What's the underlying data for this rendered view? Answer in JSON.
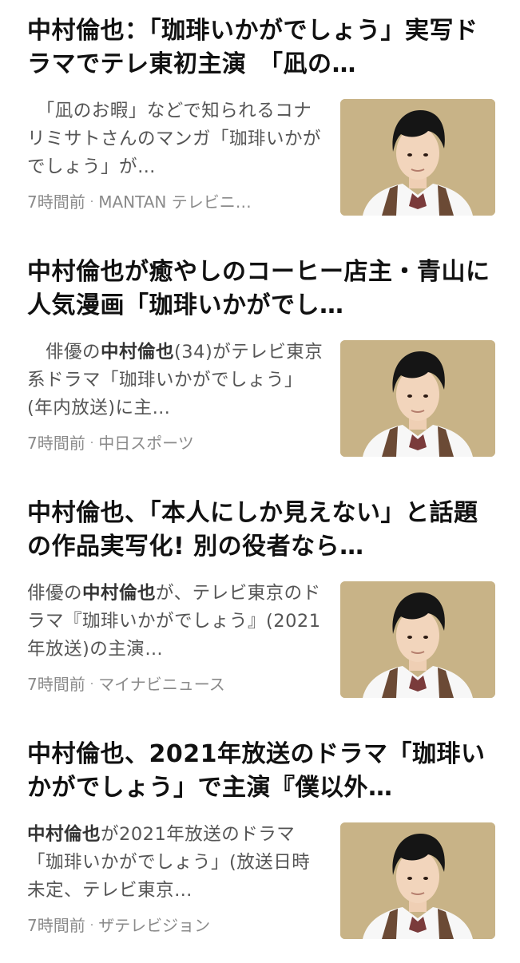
{
  "articles": [
    {
      "headline": "中村倫也：「珈琲いかがでしょう」実写ドラマでテレ東初主演　「凪の…",
      "snippet_before": "　「凪のお暇」などで知られるコナリミサトさんのマンガ「珈琲いかがでしょう」が…",
      "snippet_bold": "",
      "snippet_after": "",
      "time": "7時間前",
      "source": "MANTAN テレビニ…",
      "thumbnail_icon": "actor-portrait-thumbnail"
    },
    {
      "headline": "中村倫也が癒やしのコーヒー店主・青山に 人気漫画「珈琲いかがでし…",
      "snippet_before": "　俳優の",
      "snippet_bold": "中村倫也",
      "snippet_after": "(34)がテレビ東京系ドラマ「珈琲いかがでしょう」(年内放送)に主…",
      "time": "7時間前",
      "source": "中日スポーツ",
      "thumbnail_icon": "actor-portrait-thumbnail"
    },
    {
      "headline": "中村倫也、「本人にしか見えない」と話題の作品実写化! 別の役者なら…",
      "snippet_before": "俳優の",
      "snippet_bold": "中村倫也",
      "snippet_after": "が、テレビ東京のドラマ『珈琲いかがでしょう』(2021年放送)の主演…",
      "time": "7時間前",
      "source": "マイナビニュース",
      "thumbnail_icon": "actor-portrait-thumbnail"
    },
    {
      "headline": "中村倫也、2021年放送のドラマ「珈琲いかがでしょう」で主演『僕以外…",
      "snippet_before": "",
      "snippet_bold": "中村倫也",
      "snippet_after": "が2021年放送のドラマ「珈琲いかがでしょう」(放送日時未定、テレビ東京…",
      "time": "7時間前",
      "source": "ザテレビジョン",
      "thumbnail_icon": "actor-portrait-thumbnail"
    }
  ],
  "colors": {
    "headline": "#111111",
    "snippet": "#555555",
    "meta": "#8a8a8a",
    "thumbnail_bg": "#c8b387"
  }
}
